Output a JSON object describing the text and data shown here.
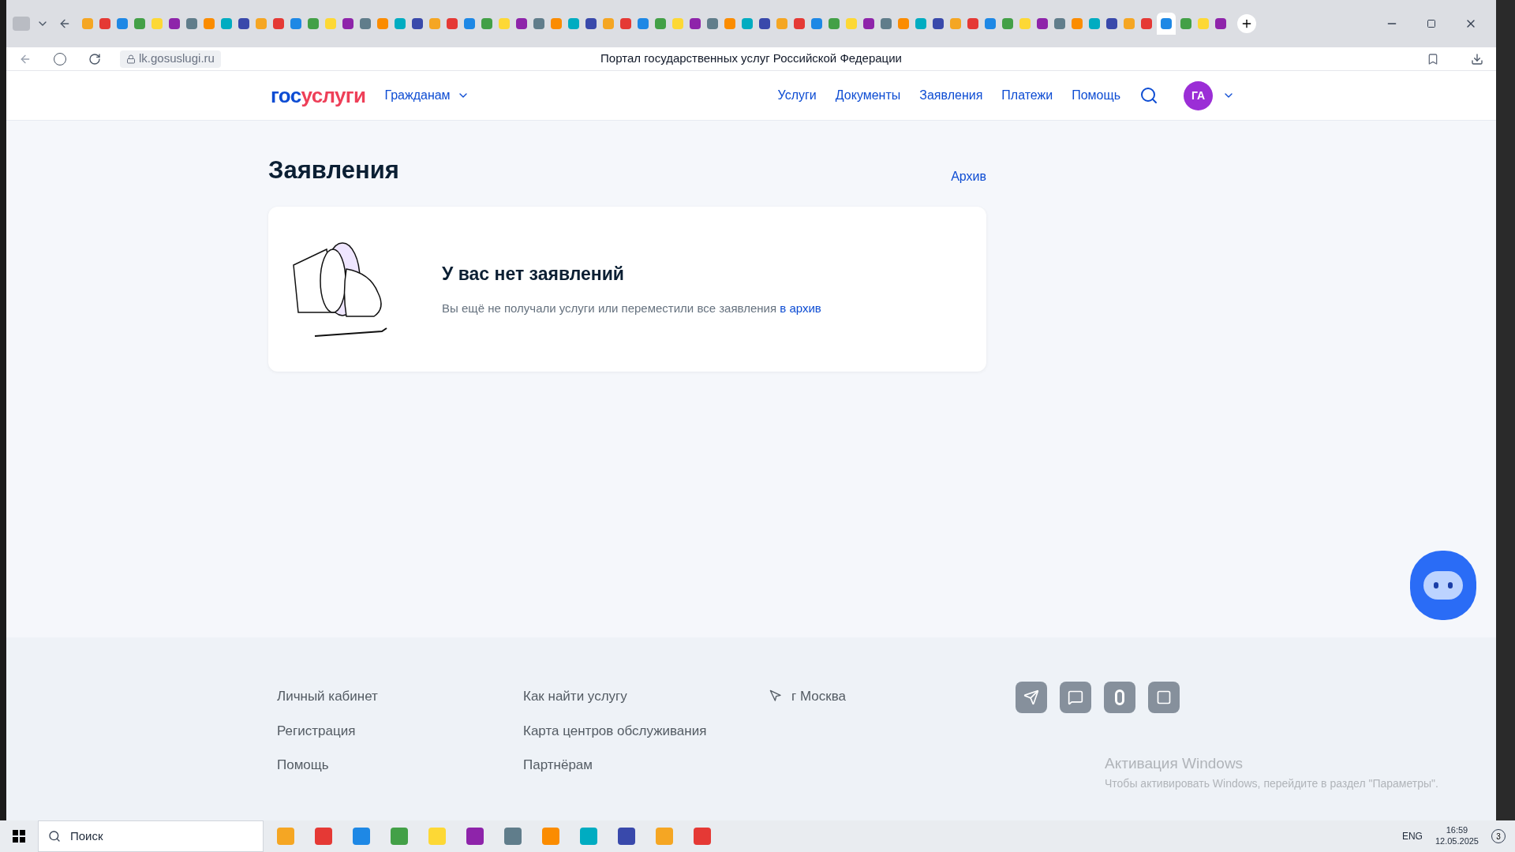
{
  "browser": {
    "tabs": [
      {
        "selected": false
      },
      {
        "selected": false
      },
      {
        "selected": false
      },
      {
        "selected": false
      },
      {
        "selected": false
      },
      {
        "selected": false
      },
      {
        "selected": false
      },
      {
        "selected": false
      },
      {
        "selected": false
      },
      {
        "selected": false
      },
      {
        "selected": false
      },
      {
        "selected": false
      },
      {
        "selected": false
      },
      {
        "selected": false
      },
      {
        "selected": false
      },
      {
        "selected": false
      },
      {
        "selected": false
      },
      {
        "selected": false
      },
      {
        "selected": false
      },
      {
        "selected": false
      },
      {
        "selected": false
      },
      {
        "selected": false
      },
      {
        "selected": false
      },
      {
        "selected": false
      },
      {
        "selected": false
      },
      {
        "selected": false
      },
      {
        "selected": false
      },
      {
        "selected": false
      },
      {
        "selected": false
      },
      {
        "selected": false
      },
      {
        "selected": false
      },
      {
        "selected": false
      },
      {
        "selected": false
      },
      {
        "selected": false
      },
      {
        "selected": false
      },
      {
        "selected": false
      },
      {
        "selected": false
      },
      {
        "selected": false
      },
      {
        "selected": false
      },
      {
        "selected": false
      },
      {
        "selected": false
      },
      {
        "selected": false
      },
      {
        "selected": false
      },
      {
        "selected": false
      },
      {
        "selected": false
      },
      {
        "selected": false
      },
      {
        "selected": false
      },
      {
        "selected": false
      },
      {
        "selected": false
      },
      {
        "selected": false
      },
      {
        "selected": false
      },
      {
        "selected": false
      },
      {
        "selected": false
      },
      {
        "selected": false
      },
      {
        "selected": false
      },
      {
        "selected": false
      },
      {
        "selected": false
      },
      {
        "selected": false
      },
      {
        "selected": false
      },
      {
        "selected": false
      },
      {
        "selected": false
      },
      {
        "selected": false
      },
      {
        "selected": true
      },
      {
        "selected": false
      },
      {
        "selected": false
      },
      {
        "selected": false
      }
    ],
    "url": "lk.gosuslugi.ru",
    "page_title": "Портал государственных услуг Российской Федерации"
  },
  "header": {
    "logo": [
      "гос",
      "услуги"
    ],
    "audience": "Гражданам",
    "nav": [
      "Услуги",
      "Документы",
      "Заявления",
      "Платежи",
      "Помощь"
    ],
    "avatar": "ГА"
  },
  "main": {
    "title": "Заявления",
    "archive_link": "Архив",
    "empty_title": "У вас нет заявлений",
    "empty_text": "Вы ещё не получали услуги или переместили все заявления",
    "empty_link": "в архив"
  },
  "footer": {
    "columns": [
      [
        "Личный кабинет",
        "Регистрация",
        "Помощь"
      ],
      [
        "Как найти услугу",
        "Карта центров обслуживания",
        "Партнёрам"
      ]
    ],
    "city": "г Москва"
  },
  "watermark": {
    "title": "Активация Windows",
    "text": "Чтобы активировать Windows, перейдите в раздел \"Параметры\"."
  },
  "taskbar": {
    "search": "Поиск",
    "language": "ENG",
    "time": "16:59",
    "date": "12.05.2025",
    "notifications": "3"
  }
}
